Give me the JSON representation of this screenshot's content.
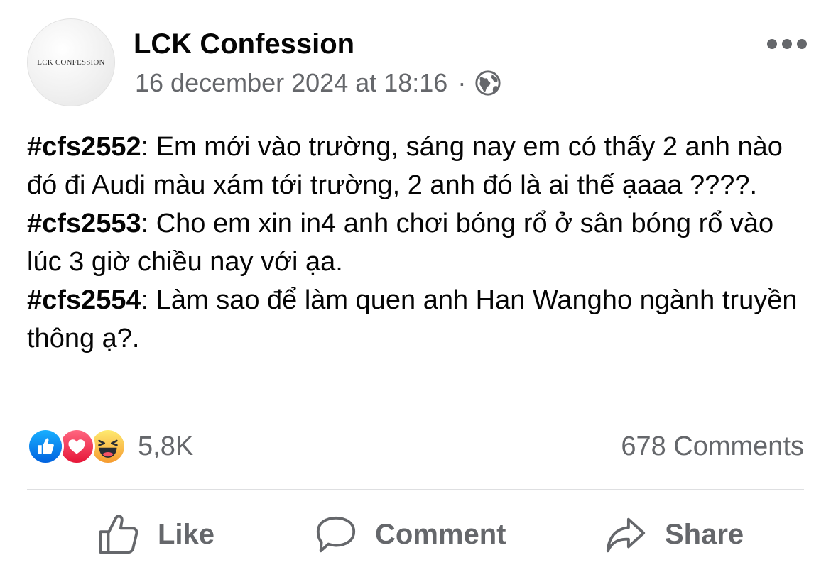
{
  "page": {
    "name": "LCK Confession",
    "avatar_text": "LCK CONFESSION",
    "timestamp": "16 december 2024 at 18:16",
    "separator": "·"
  },
  "icons": {
    "privacy": "globe-icon",
    "more": "more-options-icon",
    "reactions": [
      "like-reaction-icon",
      "love-reaction-icon",
      "haha-reaction-icon"
    ],
    "like": "thumbs-up-icon",
    "comment": "speech-bubble-icon",
    "share": "share-arrow-icon"
  },
  "post": {
    "confessions": [
      {
        "tag": "#cfs2552",
        "text": ": Em mới vào trường, sáng nay em có thấy 2 anh nào đó đi Audi màu xám tới trường, 2 anh đó là ai thế ạaaa ????."
      },
      {
        "tag": "#cfs2553",
        "text": ": Cho em xin in4 anh chơi bóng rổ ở sân bóng rổ vào lúc 3 giờ chiều nay với ạa."
      },
      {
        "tag": "#cfs2554",
        "text": ": Làm sao để làm quen anh Han Wangho ngành truyền thông ạ?."
      }
    ]
  },
  "stats": {
    "reaction_count": "5,8K",
    "comment_count": "678 Comments"
  },
  "actions": {
    "like": "Like",
    "comment": "Comment",
    "share": "Share"
  },
  "colors": {
    "text": "#050505",
    "secondary": "#65676b",
    "like_blue": "#1877f2",
    "love_red": "#f33e58",
    "haha_yellow": "#f7b125",
    "divider": "#dedfe1"
  }
}
